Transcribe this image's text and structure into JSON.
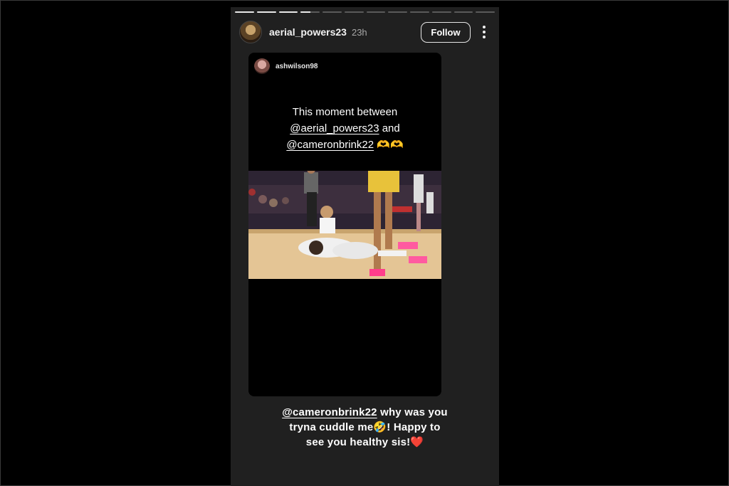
{
  "story": {
    "segments": [
      1,
      1,
      1,
      0.5,
      0,
      0,
      0,
      0,
      0,
      0,
      0,
      0
    ],
    "header": {
      "username": "aerial_powers23",
      "time": "23h",
      "follow_label": "Follow"
    },
    "reposted_card": {
      "username": "ashwilson98",
      "text": {
        "line1": "This moment between",
        "line2_mention": "@aerial_powers23",
        "line2_suffix": " and",
        "line3_mention": "@cameronbrink22",
        "line3_suffix": " 🫶🫶"
      },
      "image_icon": "basketball-game-photo"
    },
    "caption": {
      "mention": "@cameronbrink22",
      "part1": " why was you",
      "part2": "tryna cuddle me🤣! Happy to",
      "part3": "see you healthy sis!❤️"
    }
  },
  "colors": {
    "page_background": "#000000",
    "story_background": "#202020",
    "progress_active": "#e8e8e8",
    "progress_inactive": "#5a5a5a"
  }
}
